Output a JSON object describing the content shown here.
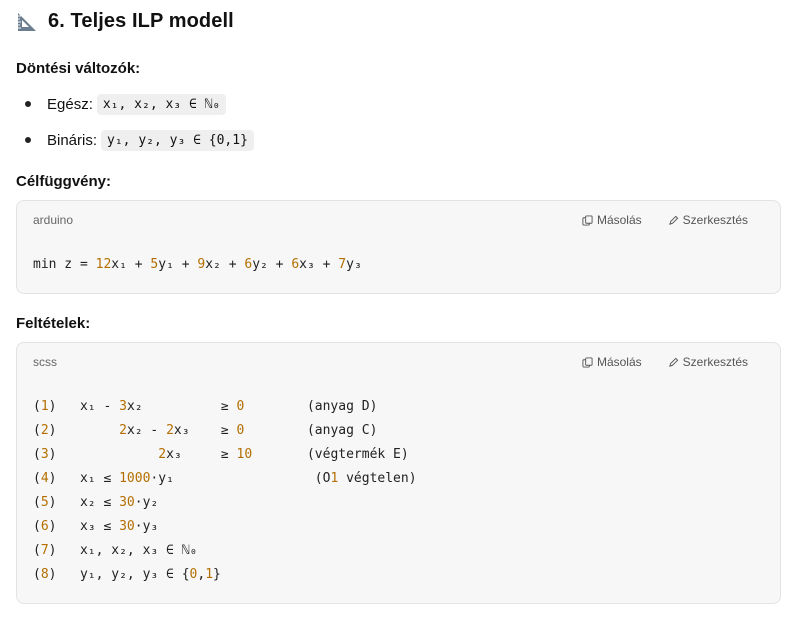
{
  "section_title": "6. Teljes ILP modell",
  "decision_vars": {
    "heading": "Döntési változók:",
    "items": [
      {
        "label": "Egész:",
        "code": "x₁, x₂, x₃ ∈ ℕ₀"
      },
      {
        "label": "Bináris:",
        "code": "y₁, y₂, y₃ ∈ {0,1}"
      }
    ]
  },
  "objective": {
    "heading": "Célfüggvény:",
    "lang": "arduino",
    "copy_label": "Másolás",
    "edit_label": "Szerkesztés",
    "code": "min z = 12x₁ + 5y₁ + 9x₂ + 6y₂ + 6x₃ + 7y₃"
  },
  "constraints": {
    "heading": "Feltételek:",
    "lang": "scss",
    "copy_label": "Másolás",
    "edit_label": "Szerkesztés",
    "lines": [
      "(1)   x₁ - 3x₂          ≥ 0        (anyag D)",
      "(2)        2x₂ - 2x₃    ≥ 0        (anyag C)",
      "(3)             2x₃     ≥ 10       (végtermék E)",
      "(4)   x₁ ≤ 1000·y₁                  (O1 végtelen)",
      "(5)   x₂ ≤ 30·y₂",
      "(6)   x₃ ≤ 30·y₃",
      "(7)   x₁, x₂, x₃ ∈ ℕ₀",
      "(8)   y₁, y₂, y₃ ∈ {0,1}"
    ]
  },
  "icons": {
    "title": "triangular-ruler-icon",
    "copy": "copy-icon",
    "edit": "pencil-icon"
  },
  "colors": {
    "number": "#b46e00",
    "code_bg": "#f7f7f7",
    "inline_code_bg": "#efefef"
  }
}
